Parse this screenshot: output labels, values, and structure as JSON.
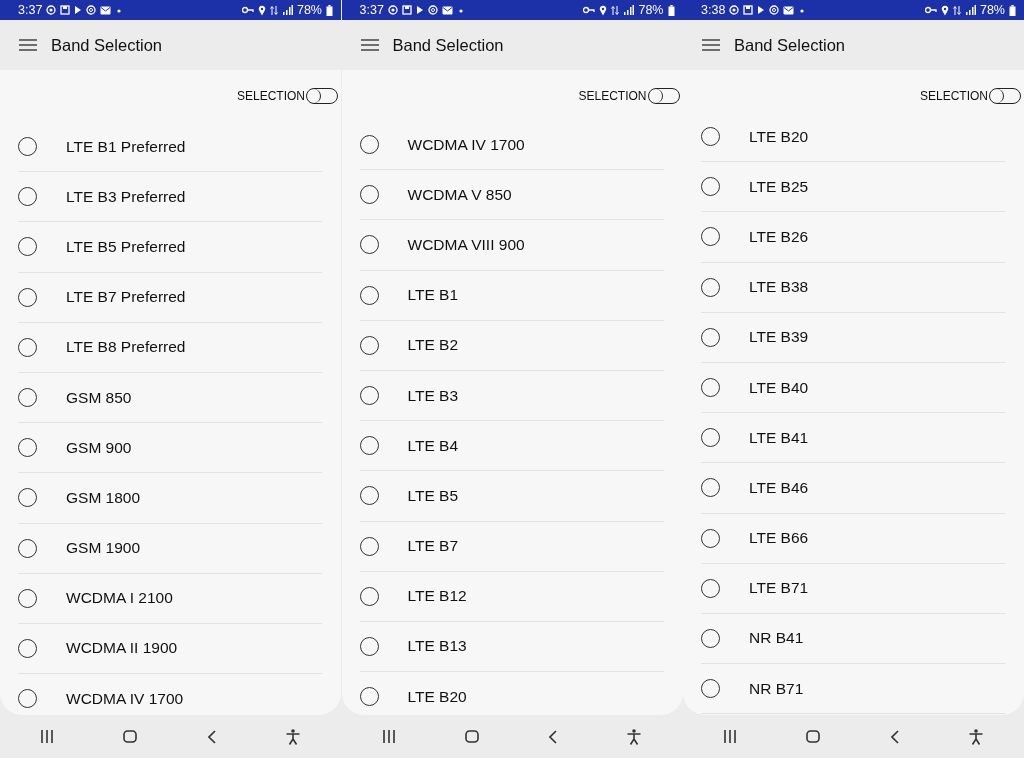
{
  "screens": [
    {
      "status_bar": {
        "time": "3:37",
        "battery": "78%"
      },
      "app_bar": {
        "title": "Band Selection"
      },
      "selection_switch": {
        "label": "SELECTION",
        "on": false
      },
      "bands": [
        {
          "label": "LTE B1 Preferred",
          "selected": false
        },
        {
          "label": "LTE B3 Preferred",
          "selected": false
        },
        {
          "label": "LTE B5 Preferred",
          "selected": false
        },
        {
          "label": "LTE B7 Preferred",
          "selected": false
        },
        {
          "label": "LTE B8 Preferred",
          "selected": false
        },
        {
          "label": "GSM 850",
          "selected": false
        },
        {
          "label": "GSM 900",
          "selected": false
        },
        {
          "label": "GSM 1800",
          "selected": false
        },
        {
          "label": "GSM 1900",
          "selected": false
        },
        {
          "label": "WCDMA I 2100",
          "selected": false
        },
        {
          "label": "WCDMA II 1900",
          "selected": false
        },
        {
          "label": "WCDMA IV 1700",
          "selected": false
        }
      ]
    },
    {
      "status_bar": {
        "time": "3:37",
        "battery": "78%"
      },
      "app_bar": {
        "title": "Band Selection"
      },
      "selection_switch": {
        "label": "SELECTION",
        "on": false
      },
      "bands": [
        {
          "label": "WCDMA IV 1700",
          "selected": false
        },
        {
          "label": "WCDMA V 850",
          "selected": false
        },
        {
          "label": "WCDMA VIII 900",
          "selected": false
        },
        {
          "label": "LTE B1",
          "selected": false
        },
        {
          "label": "LTE B2",
          "selected": false
        },
        {
          "label": "LTE B3",
          "selected": false
        },
        {
          "label": "LTE B4",
          "selected": false
        },
        {
          "label": "LTE B5",
          "selected": false
        },
        {
          "label": "LTE B7",
          "selected": false
        },
        {
          "label": "LTE B12",
          "selected": false
        },
        {
          "label": "LTE B13",
          "selected": false
        },
        {
          "label": "LTE B20",
          "selected": false
        }
      ]
    },
    {
      "status_bar": {
        "time": "3:38",
        "battery": "78%"
      },
      "app_bar": {
        "title": "Band Selection"
      },
      "selection_switch": {
        "label": "SELECTION",
        "on": false
      },
      "bands": [
        {
          "label": "LTE B20",
          "selected": false
        },
        {
          "label": "LTE B25",
          "selected": false
        },
        {
          "label": "LTE B26",
          "selected": false
        },
        {
          "label": "LTE B38",
          "selected": false
        },
        {
          "label": "LTE B39",
          "selected": false
        },
        {
          "label": "LTE B40",
          "selected": false
        },
        {
          "label": "LTE B41",
          "selected": false
        },
        {
          "label": "LTE B46",
          "selected": false
        },
        {
          "label": "LTE B66",
          "selected": false
        },
        {
          "label": "LTE B71",
          "selected": false
        },
        {
          "label": "NR B41",
          "selected": false
        },
        {
          "label": "NR B71",
          "selected": false
        }
      ]
    }
  ]
}
